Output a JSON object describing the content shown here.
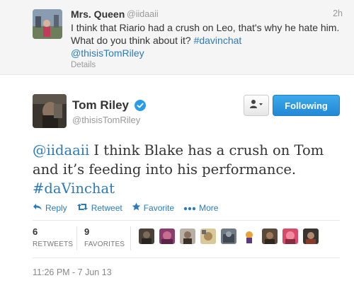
{
  "parent_tweet": {
    "name": "Mrs. Queen",
    "handle": "@iidaaii",
    "time": "2h",
    "text_plain": "I think that Riario had a crush on Leo, that's why he hate him. What do you think about it?",
    "hashtag": "#davinchat",
    "mention": "@thisisTomRiley",
    "details_label": "Details"
  },
  "main_tweet": {
    "name": "Tom Riley",
    "handle": "@thisisTomRiley",
    "verified_icon": "verified-badge-icon",
    "follow_button_label": "Following",
    "mention": "@iidaaii",
    "text_plain": "I think Blake has a crush on Tom and it’s feeding into his performance.",
    "hashtag": "#daVinchat",
    "actions": {
      "reply": "Reply",
      "retweet": "Retweet",
      "favorite": "Favorite",
      "more": "More"
    },
    "stats": {
      "retweets_count": "6",
      "retweets_label": "RETWEETS",
      "favorites_count": "9",
      "favorites_label": "FAVORITES"
    },
    "timestamp": "11:26 PM - 7 Jun 13"
  },
  "colors": {
    "link": "#2b7bb9",
    "follow_button": "#2288d6",
    "parent_bg": "#f5f5f5"
  }
}
